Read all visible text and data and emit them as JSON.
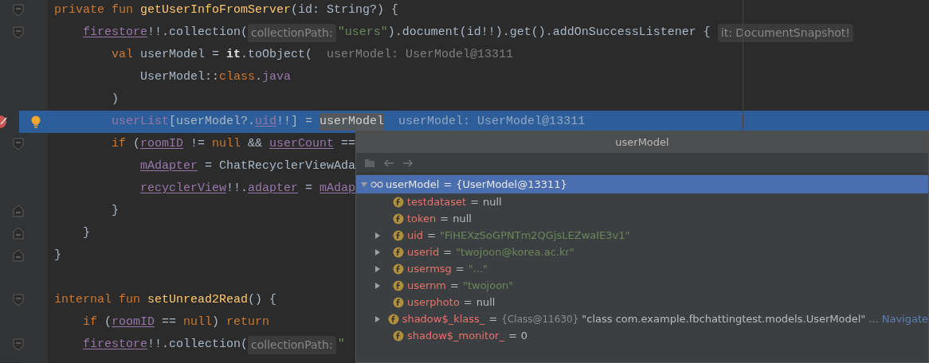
{
  "editor": {
    "lines": [
      {
        "fold_start": true,
        "tokens": [
          {
            "text": "private fun ",
            "kind": "keyword"
          },
          {
            "text": "getUserInfoFromServer",
            "kind": "function"
          },
          {
            "text": "(id: String?) {",
            "kind": "plain"
          }
        ],
        "children": [
          {
            "fold_start": true,
            "tokens": [
              {
                "text": "firestore",
                "kind": "field_ref"
              },
              {
                "text": "!!.collection(",
                "kind": "plain"
              },
              {
                "text": "collectionPath:",
                "kind": "param_hint"
              },
              {
                "text": "\"users\"",
                "kind": "string"
              },
              {
                "text": ").document(id!!).get().addOnSuccessListener { ",
                "kind": "plain"
              },
              {
                "text": "it: DocumentSnapshot!",
                "kind": "param_hint"
              }
            ],
            "children": [
              {
                "tokens": [
                  {
                    "text": "val ",
                    "kind": "keyword"
                  },
                  {
                    "text": "userModel = ",
                    "kind": "plain"
                  },
                  {
                    "text": "it",
                    "kind": "bold"
                  },
                  {
                    "text": ".toObject(",
                    "kind": "plain"
                  },
                  {
                    "text": "userModel: UserModel@13311",
                    "kind": "value_hint"
                  }
                ],
                "children": [
                  {
                    "tokens": [
                      {
                        "text": "UserModel::",
                        "kind": "plain"
                      },
                      {
                        "text": "class",
                        "kind": "keyword"
                      },
                      {
                        "text": ".",
                        "kind": "plain"
                      },
                      {
                        "text": "java",
                        "kind": "field"
                      }
                    ]
                  }
                ]
              },
              {
                "tokens": [
                  {
                    "text": ")",
                    "kind": "plain"
                  }
                ]
              },
              {
                "highlighted": true,
                "breakpoint": true,
                "intention_bulb": true,
                "tokens": [
                  {
                    "text": "userList",
                    "kind": "field"
                  },
                  {
                    "text": "[userModel?.",
                    "kind": "plain"
                  },
                  {
                    "text": "uid",
                    "kind": "field_ref"
                  },
                  {
                    "text": "!!] = ",
                    "kind": "plain"
                  },
                  {
                    "text": "userModel",
                    "kind": "usage"
                  },
                  {
                    "text": "userModel: UserModel@13311",
                    "kind": "value_hint"
                  }
                ]
              },
              {
                "fold_start": true,
                "tokens": [
                  {
                    "text": "if ",
                    "kind": "keyword"
                  },
                  {
                    "text": "(",
                    "kind": "plain"
                  },
                  {
                    "text": "roomID",
                    "kind": "field_ref"
                  },
                  {
                    "text": " != ",
                    "kind": "plain"
                  },
                  {
                    "text": "null ",
                    "kind": "keyword"
                  },
                  {
                    "text": "&& ",
                    "kind": "plain"
                  },
                  {
                    "text": "userCount",
                    "kind": "field_ref"
                  },
                  {
                    "text": " ==",
                    "kind": "plain"
                  }
                ],
                "children": [
                  {
                    "tokens": [
                      {
                        "text": "mAdapter",
                        "kind": "field_ref"
                      },
                      {
                        "text": " = ChatRecyclerViewAda",
                        "kind": "plain"
                      }
                    ]
                  },
                  {
                    "tokens": [
                      {
                        "text": "recyclerView",
                        "kind": "field_ref"
                      },
                      {
                        "text": "!!.",
                        "kind": "plain"
                      },
                      {
                        "text": "adapter",
                        "kind": "field_ref"
                      },
                      {
                        "text": " = ",
                        "kind": "plain"
                      },
                      {
                        "text": "mAdap",
                        "kind": "field_ref"
                      }
                    ]
                  }
                ]
              },
              {
                "fold_end": true,
                "tokens": [
                  {
                    "text": "}",
                    "kind": "plain"
                  }
                ]
              }
            ]
          },
          {
            "fold_end": true,
            "tokens": [
              {
                "text": "}",
                "kind": "plain"
              }
            ]
          }
        ]
      },
      {
        "fold_end": true,
        "tokens": [
          {
            "text": "}",
            "kind": "plain"
          }
        ]
      },
      {
        "kind": "blank"
      },
      {
        "fold_start": true,
        "tokens": [
          {
            "text": "internal fun ",
            "kind": "keyword"
          },
          {
            "text": "setUnread2Read",
            "kind": "function"
          },
          {
            "text": "() {",
            "kind": "plain"
          }
        ],
        "children": [
          {
            "tokens": [
              {
                "text": "if ",
                "kind": "keyword"
              },
              {
                "text": "(",
                "kind": "plain"
              },
              {
                "text": "roomID",
                "kind": "field_ref"
              },
              {
                "text": " == ",
                "kind": "plain"
              },
              {
                "text": "null",
                "kind": "keyword"
              },
              {
                "text": ") ",
                "kind": "plain"
              },
              {
                "text": "return",
                "kind": "keyword"
              }
            ]
          },
          {
            "fold_start": true,
            "tokens": [
              {
                "text": "firestore",
                "kind": "field_ref"
              },
              {
                "text": "!!.collection(",
                "kind": "plain"
              },
              {
                "text": "collectionPath:",
                "kind": "param_hint"
              },
              {
                "text": "\"",
                "kind": "string"
              }
            ]
          }
        ]
      }
    ]
  },
  "popup": {
    "title": "userModel",
    "root": {
      "name": "userModel",
      "operator": "=",
      "value": "{UserModel@13311}",
      "expanded": true,
      "selected": true,
      "children": [
        {
          "name": "testdataset",
          "operator": "=",
          "value": "null",
          "string": false,
          "expandable": false
        },
        {
          "name": "token",
          "operator": "=",
          "value": "null",
          "string": false,
          "expandable": false
        },
        {
          "name": "uid",
          "operator": "=",
          "value": "\"FiHEXzSoGPNTm2QGjsLEZwaIE3v1\"",
          "string": true,
          "expandable": true
        },
        {
          "name": "userid",
          "operator": "=",
          "value": "\"twojoon@korea.ac.kr\"",
          "string": true,
          "expandable": true
        },
        {
          "name": "usermsg",
          "operator": "=",
          "value": "\"...\"",
          "string": true,
          "expandable": true
        },
        {
          "name": "usernm",
          "operator": "=",
          "value": "\"twojoon\"",
          "string": true,
          "expandable": true
        },
        {
          "name": "userphoto",
          "operator": "=",
          "value": "null",
          "string": false,
          "expandable": false
        },
        {
          "name": "shadow$_klass_",
          "operator": "=",
          "type_hint": "{Class@11630}",
          "value": "\"class com.example.fbchattingtest.models.UserModel\"",
          "string": false,
          "expandable": true,
          "ellipsis": "...",
          "link": "Navigate"
        },
        {
          "name": "shadow$_monitor_",
          "operator": "=",
          "value": "0",
          "string": false,
          "expandable": false
        }
      ]
    }
  }
}
